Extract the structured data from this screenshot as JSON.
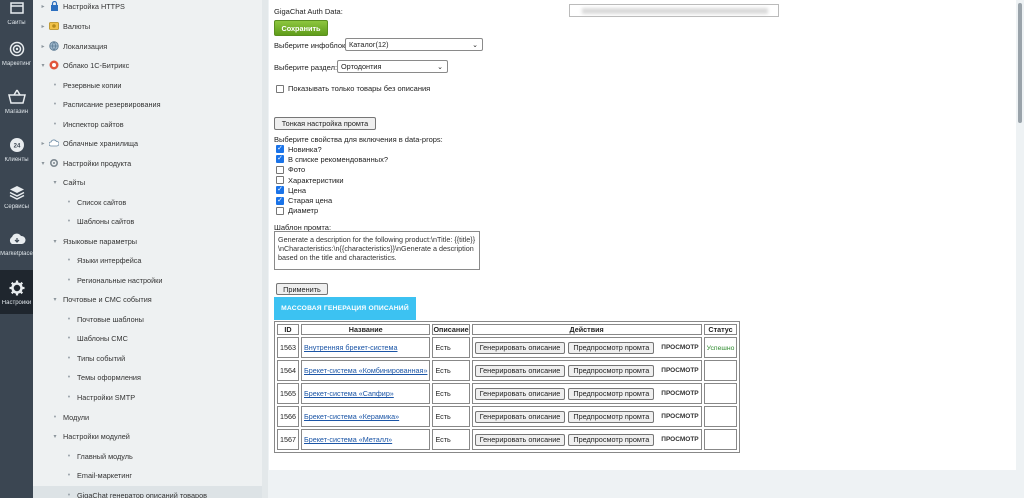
{
  "iconbar": {
    "items": [
      {
        "label": "Сайты",
        "icon": "sites-icon"
      },
      {
        "label": "Маркетинг",
        "icon": "target-icon"
      },
      {
        "label": "Магазин",
        "icon": "basket-icon"
      },
      {
        "label": "Клиенты",
        "icon": "clients-icon"
      },
      {
        "label": "Сервисы",
        "icon": "layers-icon"
      },
      {
        "label": "Marketplace",
        "icon": "cloud-icon"
      },
      {
        "label": "Настройки",
        "icon": "gear-icon"
      }
    ]
  },
  "tree": {
    "items": [
      {
        "label": "Настройка HTTPS",
        "type": "folder",
        "icon": "lock-icon"
      },
      {
        "label": "Валюты",
        "type": "folder",
        "icon": "currency-icon"
      },
      {
        "label": "Локализация",
        "type": "folder",
        "icon": "globe-icon"
      },
      {
        "label": "Облако 1С-Битрикс",
        "type": "folder-open",
        "icon": "cloud-color-icon"
      },
      {
        "label": "Резервные копии",
        "type": "leaf"
      },
      {
        "label": "Расписание резервирования",
        "type": "leaf"
      },
      {
        "label": "Инспектор сайтов",
        "type": "leaf"
      },
      {
        "label": "Облачные хранилища",
        "type": "folder",
        "icon": "storage-icon"
      },
      {
        "label": "Настройки продукта",
        "type": "folder-open",
        "icon": "product-settings-icon"
      },
      {
        "label": "Сайты",
        "type": "sub-open"
      },
      {
        "label": "Список сайтов",
        "type": "leaf2"
      },
      {
        "label": "Шаблоны сайтов",
        "type": "leaf2"
      },
      {
        "label": "Языковые параметры",
        "type": "sub-open"
      },
      {
        "label": "Языки интерфейса",
        "type": "leaf2"
      },
      {
        "label": "Региональные настройки",
        "type": "leaf2"
      },
      {
        "label": "Почтовые и СМС события",
        "type": "sub-open"
      },
      {
        "label": "Почтовые шаблоны",
        "type": "leaf2"
      },
      {
        "label": "Шаблоны СМС",
        "type": "leaf2"
      },
      {
        "label": "Типы событий",
        "type": "leaf2"
      },
      {
        "label": "Темы оформления",
        "type": "leaf2"
      },
      {
        "label": "Настройки SMTP",
        "type": "leaf2"
      },
      {
        "label": "Модули",
        "type": "leaf"
      },
      {
        "label": "Настройки модулей",
        "type": "sub-open"
      },
      {
        "label": "Главный модуль",
        "type": "leaf2"
      },
      {
        "label": "Email-маркетинг",
        "type": "leaf2"
      },
      {
        "label": "GigaChat генератор описаний товаров",
        "type": "leaf2-selected"
      }
    ]
  },
  "form": {
    "auth_label": "GigaChat Auth Data:",
    "save_label": "Сохранить",
    "infoblock_label": "Выберите инфоблок:",
    "infoblock_value": "Каталог(12)",
    "section_label": "Выберите раздел:",
    "section_value": "Ортодонтия",
    "only_no_desc_label": "Показывать только товары без описания",
    "fine_tune_label": "Тонкая настройка промта",
    "props_label": "Выберите свойства для включения в data-props:",
    "props": [
      {
        "label": "Новинка?",
        "checked": true
      },
      {
        "label": "В списке рекомендованных?",
        "checked": true
      },
      {
        "label": "Фото",
        "checked": false
      },
      {
        "label": "Характеристики",
        "checked": false
      },
      {
        "label": "Цена",
        "checked": true
      },
      {
        "label": "Старая цена",
        "checked": true
      },
      {
        "label": "Диаметр",
        "checked": false
      }
    ],
    "template_label": "Шаблон промта:",
    "template_value": "Generate a description for the following product:\\nTitle: {{title}}\\nCharacteristics:\\n{{characteristics}}\\nGenerate a description based on the title and characteristics.",
    "apply_label": "Применить",
    "mass_label": "МАССОВАЯ ГЕНЕРАЦИЯ ОПИСАНИЙ"
  },
  "table": {
    "headers": [
      "ID",
      "Название",
      "Описание",
      "Действия",
      "Статус"
    ],
    "generate_label": "Генерировать описание",
    "preview_label": "Предпросмотр промта",
    "view_label": "ПРОСМОТР",
    "rows": [
      {
        "id": "1563",
        "name": "Внутренняя брекет-система",
        "desc": "Есть",
        "status": "Успешно"
      },
      {
        "id": "1564",
        "name": "Брекет-система «Комбинированная»",
        "desc": "Есть",
        "status": ""
      },
      {
        "id": "1565",
        "name": "Брекет-система «Сапфир»",
        "desc": "Есть",
        "status": ""
      },
      {
        "id": "1566",
        "name": "Брекет-система «Керамика»",
        "desc": "Есть",
        "status": ""
      },
      {
        "id": "1567",
        "name": "Брекет-система «Металл»",
        "desc": "Есть",
        "status": ""
      }
    ]
  },
  "colors": {
    "accent_green": "#6aa823",
    "accent_blue": "#3cc2f2",
    "sidebar_dark": "#3b4652",
    "status_ok": "#2e8b2e"
  }
}
